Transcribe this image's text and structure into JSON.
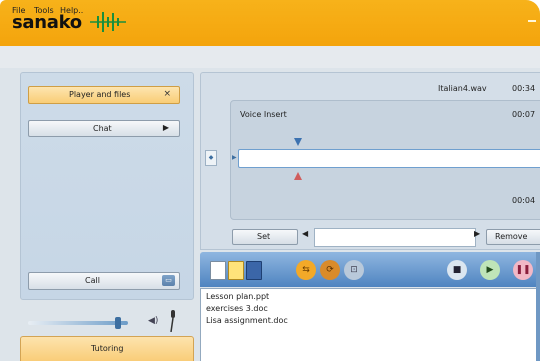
{
  "app": {
    "logo": "sanako",
    "brand_color": "#f4a40c"
  },
  "titlebar": {
    "minimize_label": "_"
  },
  "menu": {
    "file": "File",
    "tools": "Tools",
    "help": "Help.."
  },
  "sidebar": {
    "player_button": "Player and files",
    "player_close": "×",
    "chat_button": "Chat",
    "chat_arrow": "▶",
    "call_button": "Call",
    "tutoring_tab": "Tutoring"
  },
  "volume": {
    "level_fraction": 0.9
  },
  "recorder": {
    "filename": "Italian4.wav",
    "total_time": "00:34",
    "track_label": "Voice Insert",
    "track_time": "00:07",
    "position_time": "00:04",
    "set_button": "Set",
    "remove_button": "Remove",
    "bookmark_value": ""
  },
  "toolbar": {
    "icons": [
      "new-document-icon",
      "open-folder-icon",
      "save-icon",
      "loop-icon",
      "sync-icon",
      "export-icon",
      "stop-icon",
      "play-icon",
      "pause-icon"
    ]
  },
  "files": [
    "Lesson plan.ppt",
    "exercises 3.doc",
    "Lisa assignment.doc"
  ]
}
